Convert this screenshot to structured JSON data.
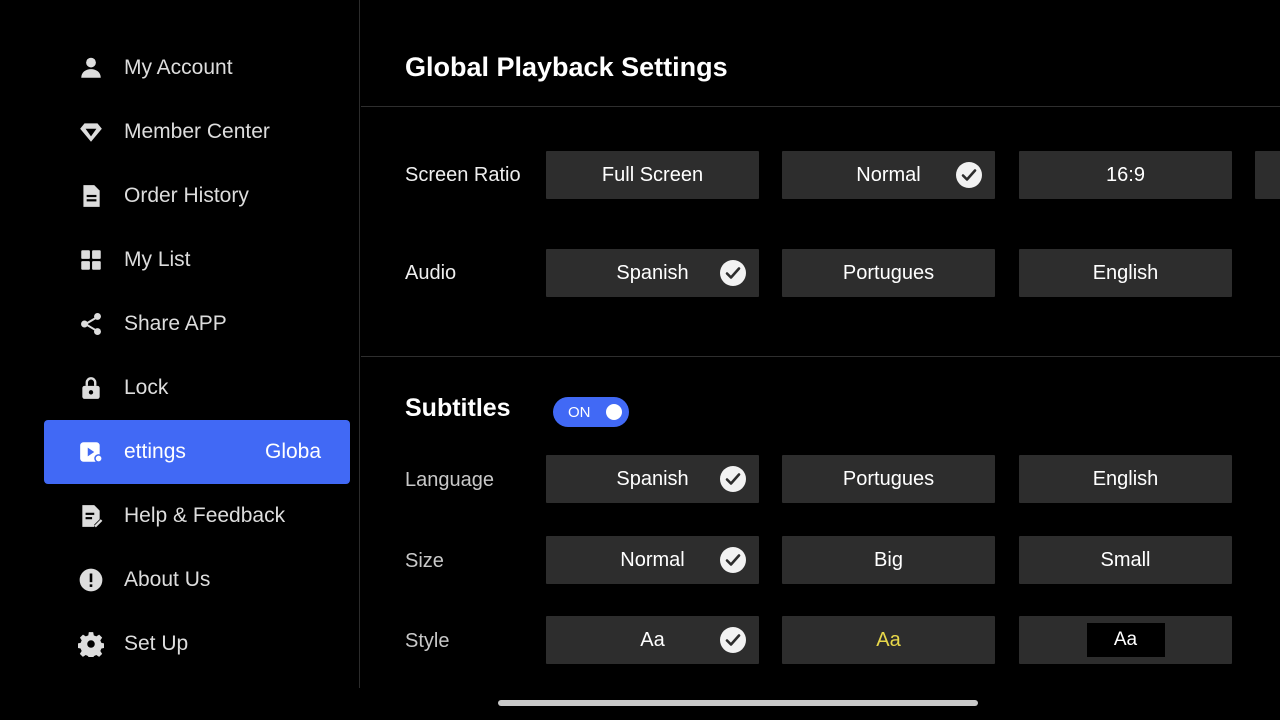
{
  "sidebar": {
    "items": [
      {
        "label": "My Account",
        "icon": "person-icon"
      },
      {
        "label": "Member Center",
        "icon": "diamond-icon"
      },
      {
        "label": "Order History",
        "icon": "document-icon"
      },
      {
        "label": "My List",
        "icon": "grid-icon"
      },
      {
        "label": "Share APP",
        "icon": "share-icon"
      },
      {
        "label": "Lock",
        "icon": "lock-icon"
      },
      {
        "label": "Settings",
        "label_visible": "ettings",
        "suffix": "Globa",
        "icon": "settings-video-icon",
        "active": true
      },
      {
        "label": "Help & Feedback",
        "icon": "feedback-icon"
      },
      {
        "label": "About Us",
        "icon": "info-icon"
      },
      {
        "label": "Set Up",
        "icon": "gear-icon"
      }
    ]
  },
  "main": {
    "title": "Global Playback Settings",
    "screen_ratio": {
      "label": "Screen Ratio",
      "options": [
        "Full Screen",
        "Normal",
        "16:9"
      ],
      "selected": "Normal"
    },
    "audio": {
      "label": "Audio",
      "options": [
        "Spanish",
        "Portugues",
        "English"
      ],
      "selected": "Spanish"
    },
    "subtitles": {
      "title": "Subtitles",
      "toggle_label": "ON",
      "toggle_on": true,
      "language": {
        "label": "Language",
        "options": [
          "Spanish",
          "Portugues",
          "English"
        ],
        "selected": "Spanish"
      },
      "size": {
        "label": "Size",
        "options": [
          "Normal",
          "Big",
          "Small"
        ],
        "selected": "Normal"
      },
      "style": {
        "label": "Style",
        "options": [
          "Aa",
          "Aa",
          "Aa"
        ],
        "selected_index": 0,
        "style_colors": [
          "#ffffff",
          "#e8d84a",
          "#ffffff"
        ]
      }
    }
  },
  "colors": {
    "accent": "#4169f5",
    "option_bg": "#2d2d2d",
    "background": "#000000"
  }
}
